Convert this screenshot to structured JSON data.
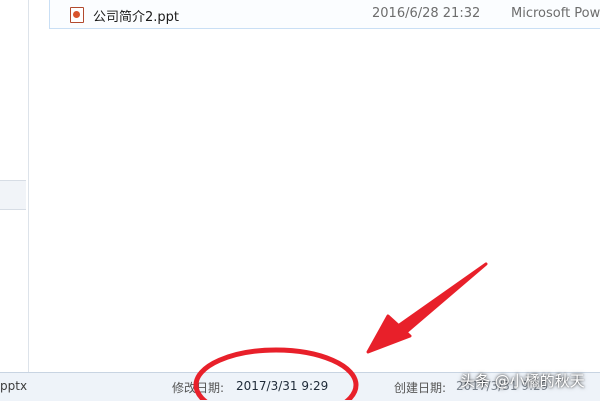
{
  "file_list": {
    "rows": [
      {
        "name": "公司简介2.ppt",
        "date_modified": "2016/6/28 21:32",
        "type": "Microsoft Power",
        "icon": "powerpoint-file-icon"
      }
    ]
  },
  "details_bar": {
    "file_name_fragment": "pptx",
    "modified_label": "修改日期:",
    "modified_value": "2017/3/31 9:29",
    "created_label": "创建日期:",
    "created_value": "2017/3/31 9:29"
  },
  "annotation": {
    "color": "#e8202a",
    "shapes": [
      "circle",
      "arrow"
    ]
  },
  "watermark": {
    "text": "头条 @小橘的秋天"
  }
}
